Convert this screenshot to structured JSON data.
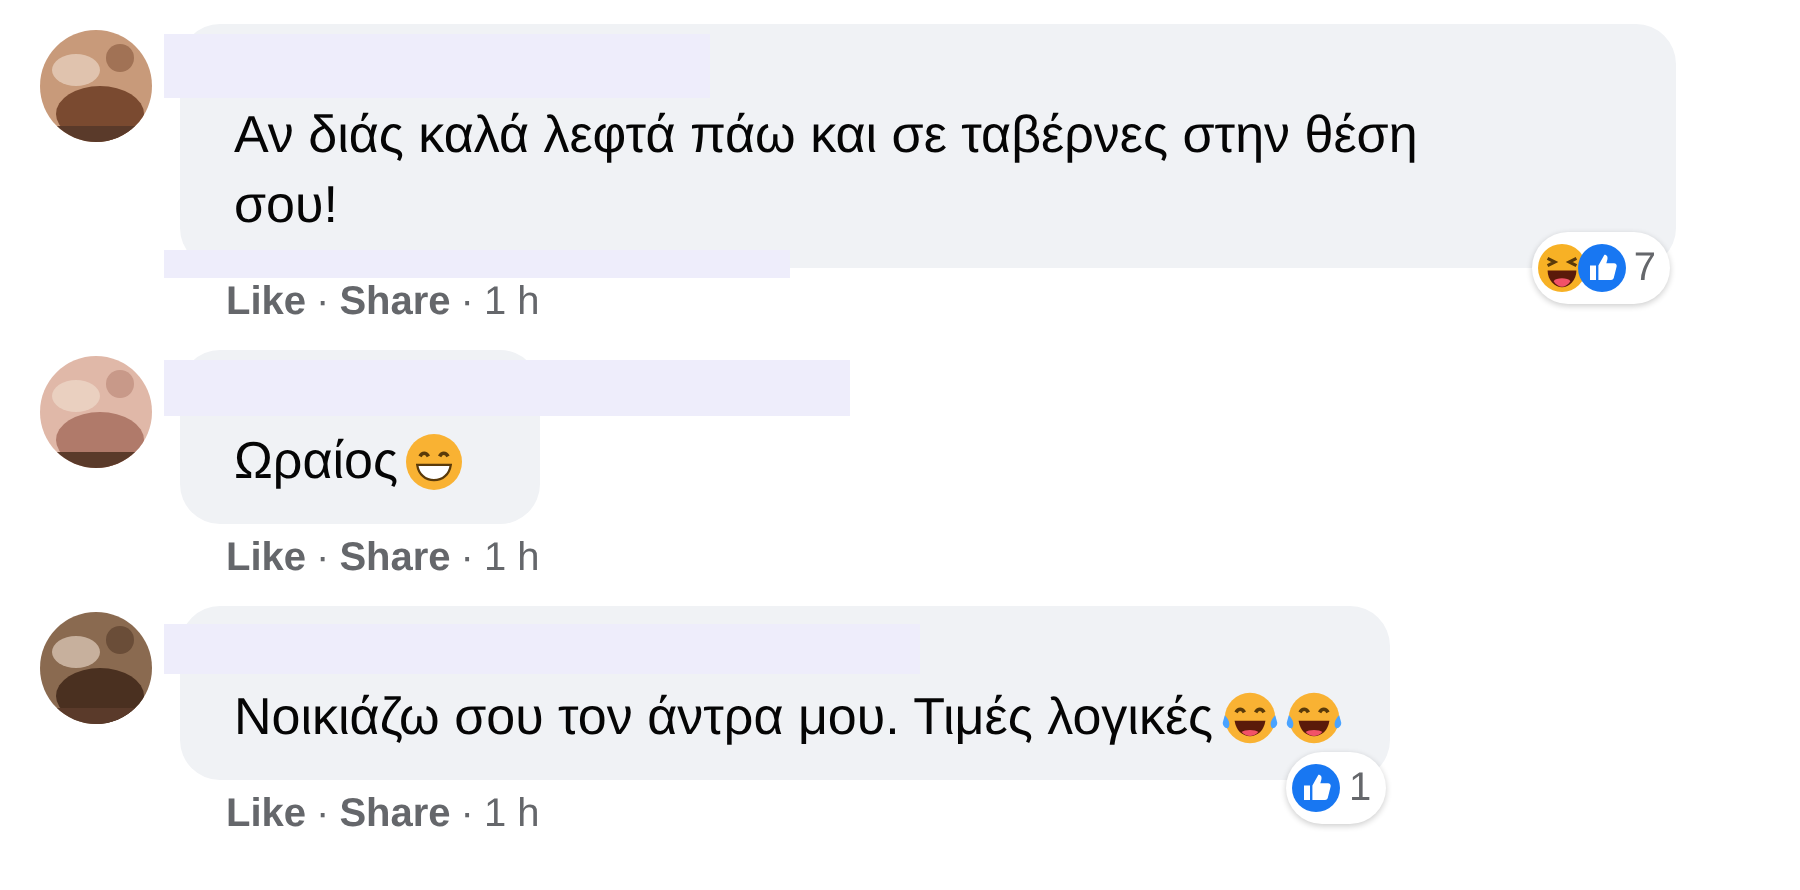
{
  "comments": [
    {
      "text": "Αν διάς καλά λεφτά πάω και σε ταβέρνες στην θέση σου!",
      "reactions": [
        {
          "kind": "haha"
        },
        {
          "kind": "like"
        }
      ],
      "reaction_count": "7",
      "meta": [
        {
          "kind": "link",
          "label": "Like"
        },
        {
          "kind": "separator",
          "label": "·"
        },
        {
          "kind": "link",
          "label": "Share"
        },
        {
          "kind": "separator",
          "label": "·"
        },
        {
          "kind": "time",
          "label": "1 h"
        }
      ]
    },
    {
      "text": "Ωραίος",
      "emojis": [
        {
          "kind": "grin"
        }
      ],
      "meta": [
        {
          "kind": "link",
          "label": "Like"
        },
        {
          "kind": "separator",
          "label": "·"
        },
        {
          "kind": "link",
          "label": "Share"
        },
        {
          "kind": "separator",
          "label": "·"
        },
        {
          "kind": "time",
          "label": "1 h"
        }
      ]
    },
    {
      "text": "Νοικιάζω σου τον άντρα μου. Τιμές λογικές",
      "emojis": [
        {
          "kind": "joy"
        },
        {
          "kind": "joy"
        }
      ],
      "reactions": [
        {
          "kind": "like"
        }
      ],
      "reaction_count": "1",
      "meta": [
        {
          "kind": "link",
          "label": "Like"
        },
        {
          "kind": "separator",
          "label": "·"
        },
        {
          "kind": "link",
          "label": "Share"
        },
        {
          "kind": "separator",
          "label": "·"
        },
        {
          "kind": "time",
          "label": "1 h"
        }
      ]
    }
  ]
}
